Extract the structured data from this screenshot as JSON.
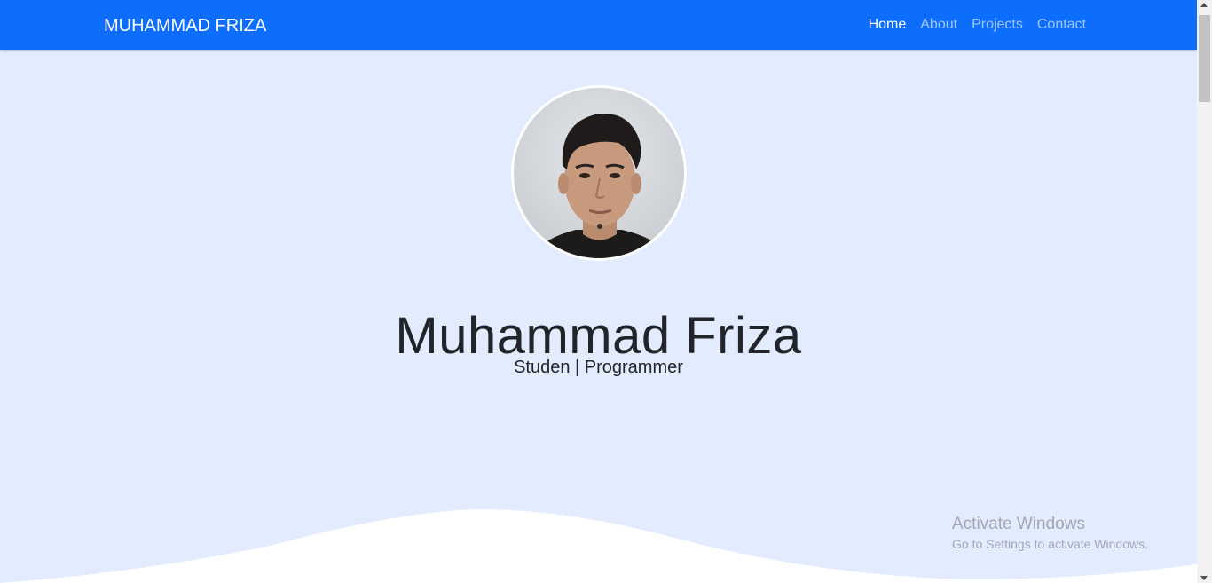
{
  "navbar": {
    "brand": "MUHAMMAD FRIZA",
    "links": [
      {
        "label": "Home",
        "active": true
      },
      {
        "label": "About",
        "active": false
      },
      {
        "label": "Projects",
        "active": false
      },
      {
        "label": "Contact",
        "active": false
      }
    ]
  },
  "hero": {
    "name": "Muhammad Friza",
    "subtitle": "Studen | Programmer",
    "avatar_icon": "profile-photo"
  },
  "watermark": {
    "title": "Activate Windows",
    "subtitle": "Go to Settings to activate Windows."
  },
  "colors": {
    "navbar": "#0d6efd",
    "hero_background": "#e2ecfe",
    "wave": "#ffffff",
    "text": "#212529"
  }
}
